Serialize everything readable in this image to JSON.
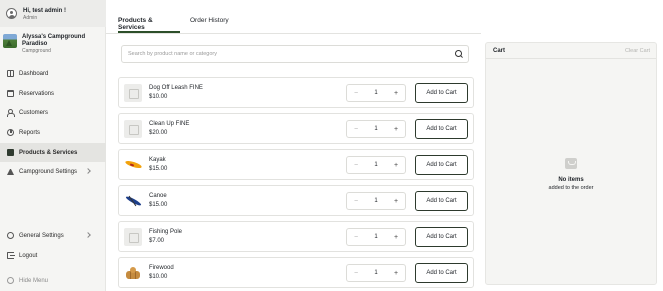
{
  "user": {
    "greeting": "Hi, test admin !",
    "role": "Admin"
  },
  "campground": {
    "name_line1": "Alyssa's Campground",
    "name_line2": "Paradiso",
    "subtitle": "Campground"
  },
  "sidebar": {
    "items": [
      {
        "label": "Dashboard",
        "icon": "dashboard-icon"
      },
      {
        "label": "Reservations",
        "icon": "calendar-icon"
      },
      {
        "label": "Customers",
        "icon": "users-icon"
      },
      {
        "label": "Reports",
        "icon": "pie-chart-icon"
      },
      {
        "label": "Products & Services",
        "icon": "box-icon",
        "active": true
      },
      {
        "label": "Campground Settings",
        "icon": "tent-icon"
      }
    ],
    "bottom": [
      {
        "label": "General Settings",
        "icon": "gear-icon"
      },
      {
        "label": "Logout",
        "icon": "logout-icon"
      },
      {
        "label": "Hide Menu",
        "icon": "hide-menu-icon"
      }
    ]
  },
  "tabs": [
    {
      "label": "Products & Services",
      "active": true
    },
    {
      "label": "Order History",
      "active": false
    }
  ],
  "search": {
    "placeholder": "Search by product name or category"
  },
  "products": [
    {
      "name": "Dog Off Leash FINE",
      "price": "$10.00",
      "qty": "1",
      "image": "placeholder"
    },
    {
      "name": "Clean Up FINE",
      "price": "$20.00",
      "qty": "1",
      "image": "placeholder"
    },
    {
      "name": "Kayak",
      "price": "$15.00",
      "qty": "1",
      "image": "kayak"
    },
    {
      "name": "Canoe",
      "price": "$15.00",
      "qty": "1",
      "image": "canoe"
    },
    {
      "name": "Fishing Pole",
      "price": "$7.00",
      "qty": "1",
      "image": "placeholder"
    },
    {
      "name": "Firewood",
      "price": "$10.00",
      "qty": "1",
      "image": "firewood"
    }
  ],
  "product_controls": {
    "minus": "−",
    "plus": "+",
    "add_label": "Add to Cart"
  },
  "cart": {
    "title": "Cart",
    "clear_label": "Clear Cart",
    "empty_title": "No items",
    "empty_subtitle": "added to the order"
  },
  "colors": {
    "accent": "#2d4f2a",
    "sidebar_bg": "#f5f5f3",
    "active_bg": "#e4e4e1"
  }
}
